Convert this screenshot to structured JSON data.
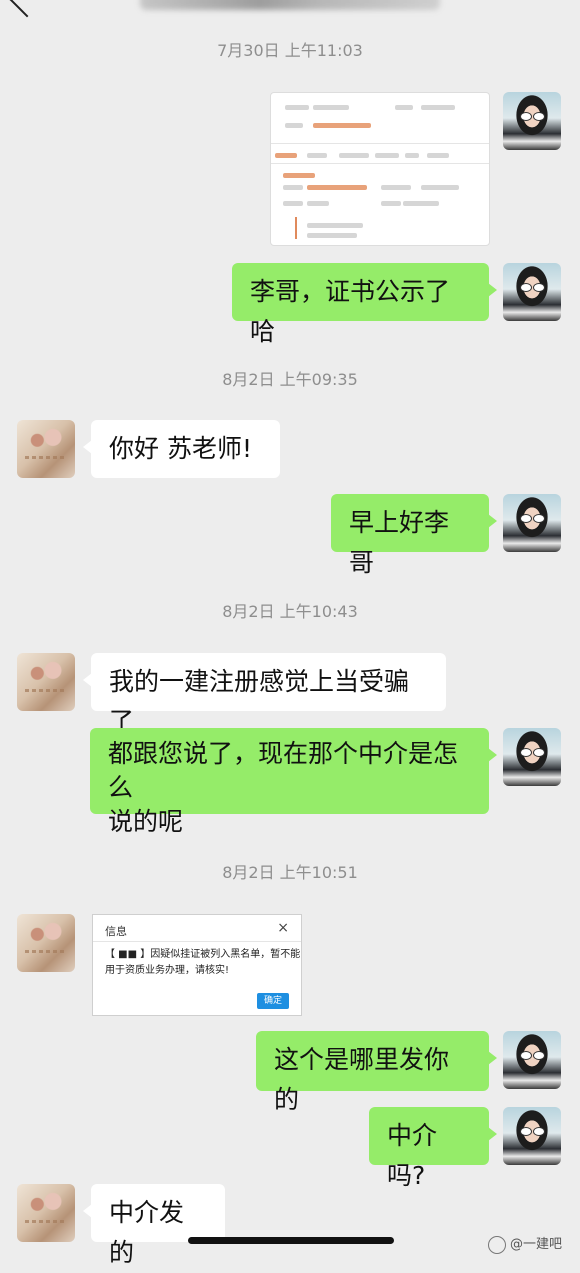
{
  "header": {
    "title_obscured": true
  },
  "timestamps": [
    "7月30日 上午11:03",
    "8月2日 上午09:35",
    "8月2日 上午10:43",
    "8月2日 上午10:51"
  ],
  "messages": {
    "m1": "李哥，证书公示了哈",
    "m2": "你好 苏老师!",
    "m3": "早上好李哥",
    "m4": "我的一建注册感觉上当受骗了",
    "m5a": "都跟您说了，现在那个中介是怎么",
    "m5b": "说的呢",
    "m6": "这个是哪里发你的",
    "m7": "中介吗?",
    "m8": "中介发的"
  },
  "dialog": {
    "title": "信息",
    "close": "×",
    "text": "【 ■■ 】因疑似挂证被列入黑名单，暂不能用于资质业务办理，请核实!",
    "ok": "确定"
  },
  "watermark": "@一建吧",
  "colors": {
    "sent_bubble": "#95ec69",
    "received_bubble": "#ffffff",
    "background": "#ededed"
  }
}
